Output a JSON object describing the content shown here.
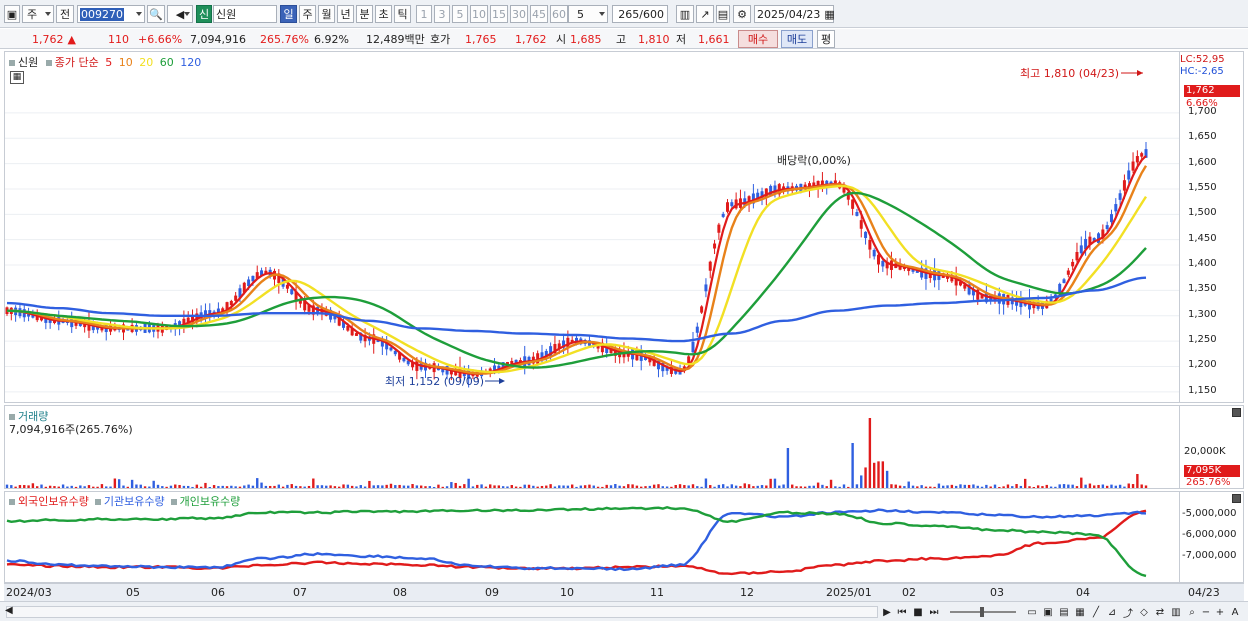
{
  "toolbar": {
    "market_label": "주",
    "prev_label": "전",
    "code": "009270",
    "stock_type_badge": "신",
    "stock_name": "신원",
    "period_tabs": [
      "일",
      "주",
      "월",
      "년",
      "분",
      "초",
      "틱"
    ],
    "active_period": "일",
    "interval_buttons": [
      "1",
      "3",
      "5",
      "10",
      "15",
      "30",
      "45",
      "60"
    ],
    "interval_select": "5",
    "count_value": "265",
    "count_total": "/600",
    "date": "2025/04/23"
  },
  "info": {
    "price": "1,762",
    "change": "110",
    "change_rate": "+6.66%",
    "volume": "7,094,916",
    "volume_ratio": "265.76%",
    "turnover": "6.92%",
    "amount": "12,489백만",
    "quote_label": "호가",
    "ask": "1,765",
    "bid": "1,762",
    "open_label": "시",
    "open": "1,685",
    "high_label": "고",
    "high": "1,810",
    "low_label": "저",
    "low": "1,661",
    "buy_label": "매수",
    "sell_label": "매도",
    "eval_label": "평"
  },
  "price_panel": {
    "stock_tag": "신원",
    "legend_label": "종가 단순",
    "ma_periods": [
      "5",
      "10",
      "20",
      "60",
      "120"
    ],
    "ma_colors": [
      "#e01b1b",
      "#e8821a",
      "#f2e024",
      "#1e9e3a",
      "#2f5fe0"
    ],
    "high_annotation": "최고 1,810 (04/23)",
    "low_annotation": "최저 1,152 (09/09)",
    "dividend_annotation": "배당락(0,00%)",
    "lc": "LC:52,95",
    "hc": "HC:-2,65",
    "current_price_tag": "1,762",
    "current_rate_tag": "6.66%",
    "price_ticks": [
      "1,700",
      "1,650",
      "1,600",
      "1,550",
      "1,500",
      "1,450",
      "1,400",
      "1,350",
      "1,300",
      "1,250",
      "1,200",
      "1,150"
    ]
  },
  "volume_panel": {
    "title": "거래량",
    "value": "7,094,916주(265.76%)",
    "tick": "20,000K",
    "current_tag": "7,095K",
    "current_rate": "265.76%"
  },
  "holdings_panel": {
    "legend": [
      "외국인보유수량",
      "기관보유수량",
      "개인보유수량"
    ],
    "legend_colors": [
      "#e01b1b",
      "#2f5fe0",
      "#1e9e3a"
    ],
    "ticks": [
      "-5,000,000",
      "-6,000,000",
      "-7,000,000"
    ]
  },
  "x_axis": {
    "labels": [
      "2024/03",
      "05",
      "06",
      "07",
      "08",
      "09",
      "10",
      "11",
      "12",
      "2025/01",
      "02",
      "03",
      "04"
    ],
    "current_label": "04/23"
  },
  "chart_data": {
    "type": "line",
    "title": "",
    "xlabel": "",
    "ylabel": "",
    "ylim": [
      1130,
      1820
    ],
    "x": [
      "2024/03",
      "2024/04",
      "2024/05",
      "2024/06",
      "2024/07",
      "2024/07b",
      "2024/08",
      "2024/08b",
      "2024/09",
      "2024/09b",
      "2024/10",
      "2024/11",
      "2024/11b",
      "2024/12",
      "2024/12b",
      "2025/01",
      "2025/01b",
      "2025/02",
      "2025/03",
      "2025/03b",
      "2025/04",
      "2025/04b",
      "2025/04/23"
    ],
    "series": [
      {
        "name": "5",
        "values": [
          1310,
          1290,
          1275,
          1275,
          1305,
          1385,
          1310,
          1255,
          1200,
          1185,
          1210,
          1250,
          1225,
          1190,
          1520,
          1550,
          1560,
          1400,
          1380,
          1335,
          1320,
          1450,
          1620
        ]
      },
      {
        "name": "120",
        "values": [
          1325,
          1315,
          1305,
          1300,
          1300,
          1305,
          1305,
          1290,
          1275,
          1270,
          1265,
          1262,
          1255,
          1250,
          1265,
          1290,
          1310,
          1320,
          1325,
          1330,
          1335,
          1350,
          1375
        ]
      }
    ]
  }
}
